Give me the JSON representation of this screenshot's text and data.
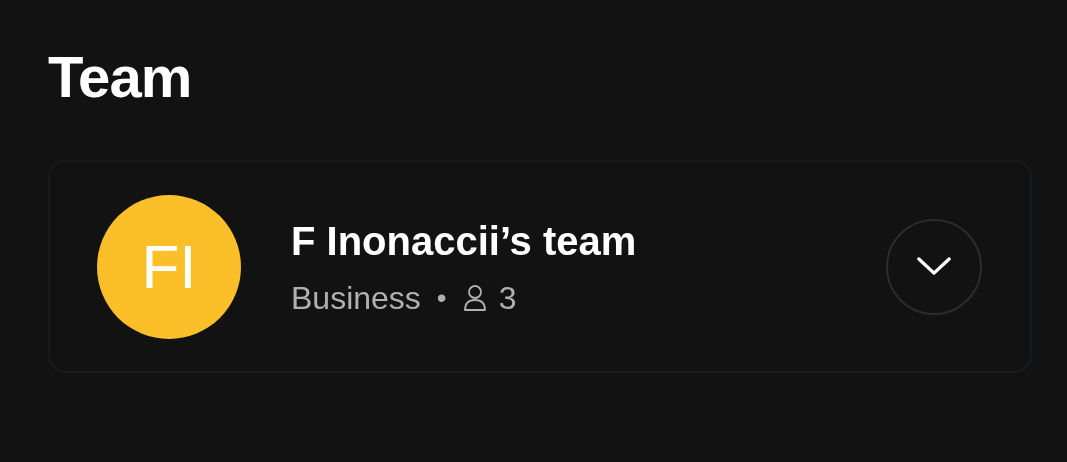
{
  "title": "Team",
  "team": {
    "initials": "FI",
    "name": "F Inonaccii’s team",
    "plan": "Business",
    "separator": "•",
    "member_count": "3"
  }
}
